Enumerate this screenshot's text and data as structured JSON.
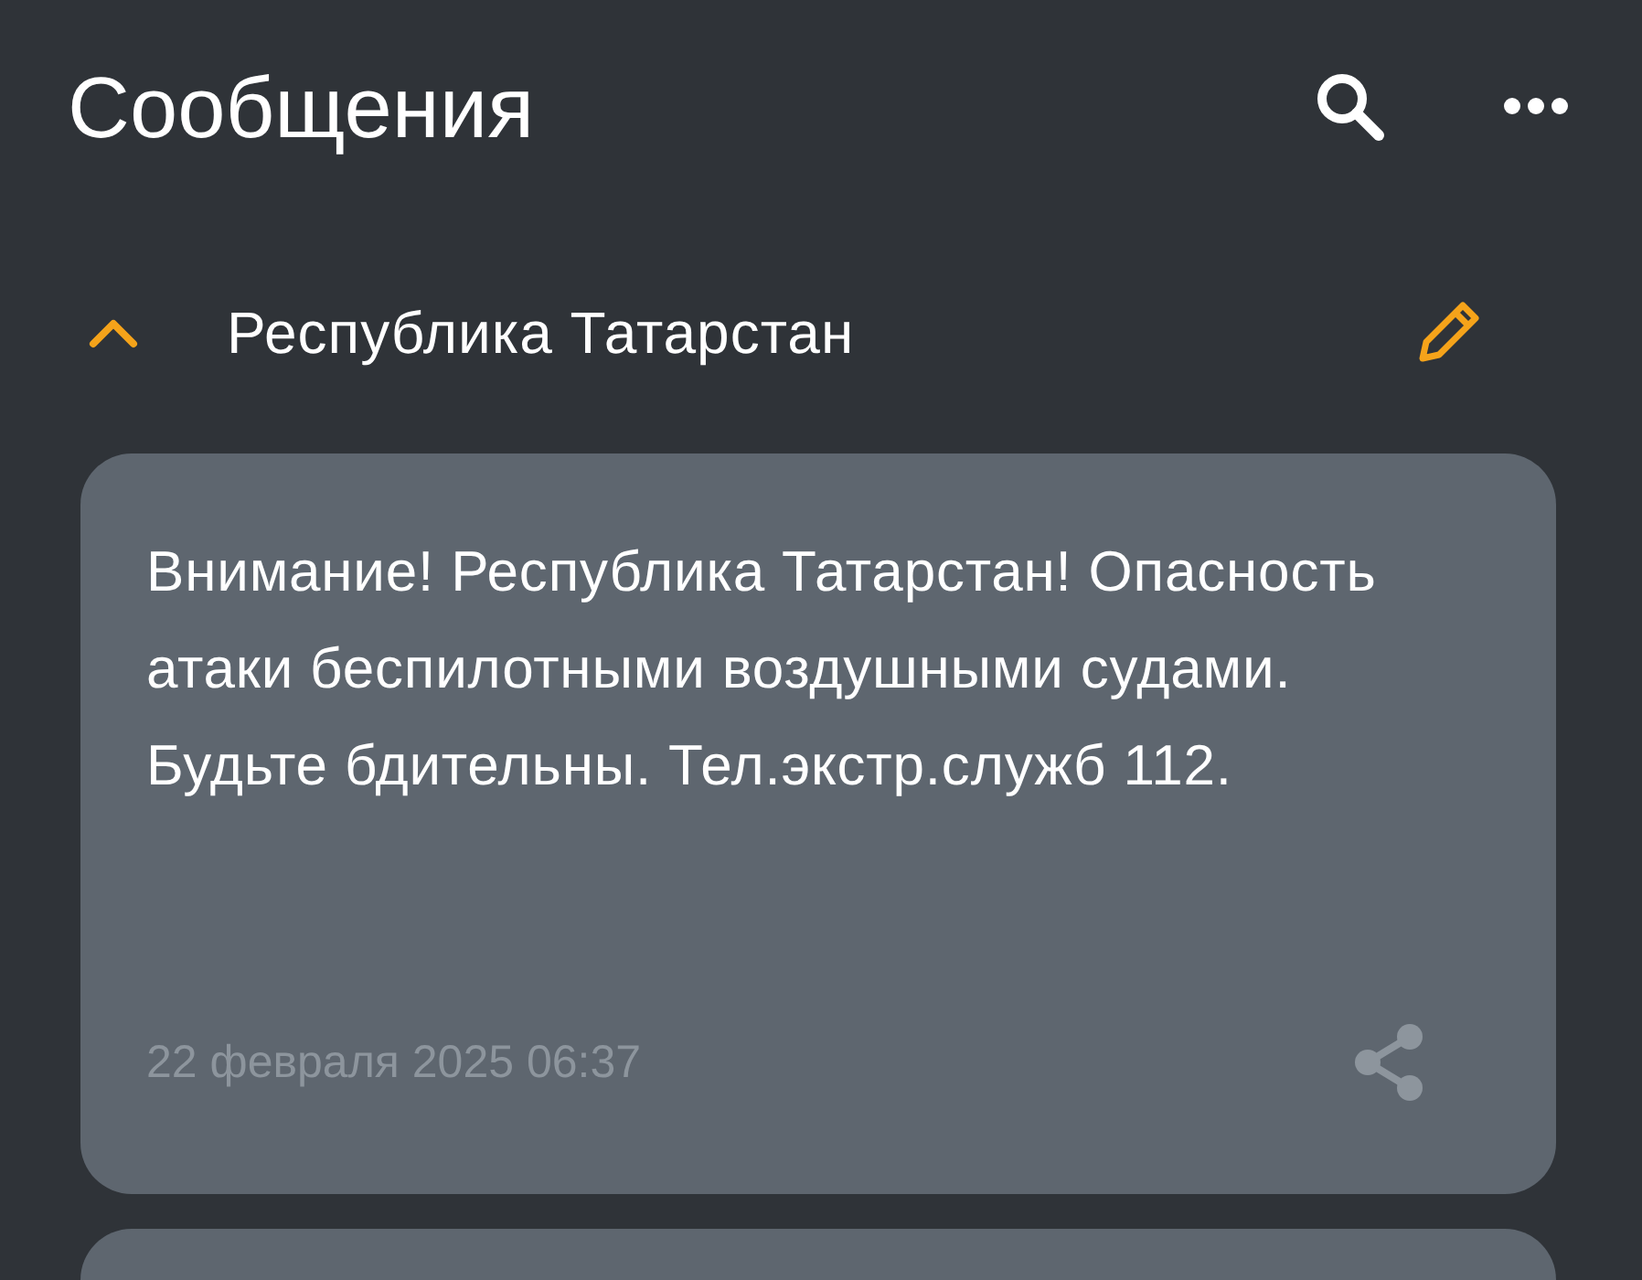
{
  "header": {
    "title": "Сообщения"
  },
  "group": {
    "name": "Республика Татарстан",
    "expanded": true
  },
  "messages": [
    {
      "text": "Внимание! Республика Татарстан! Опасность атаки беспилотными воздушными судами. Будьте бдительны. Тел.экстр.служб 112.",
      "date": "22 февраля 2025 06:37"
    }
  ]
}
